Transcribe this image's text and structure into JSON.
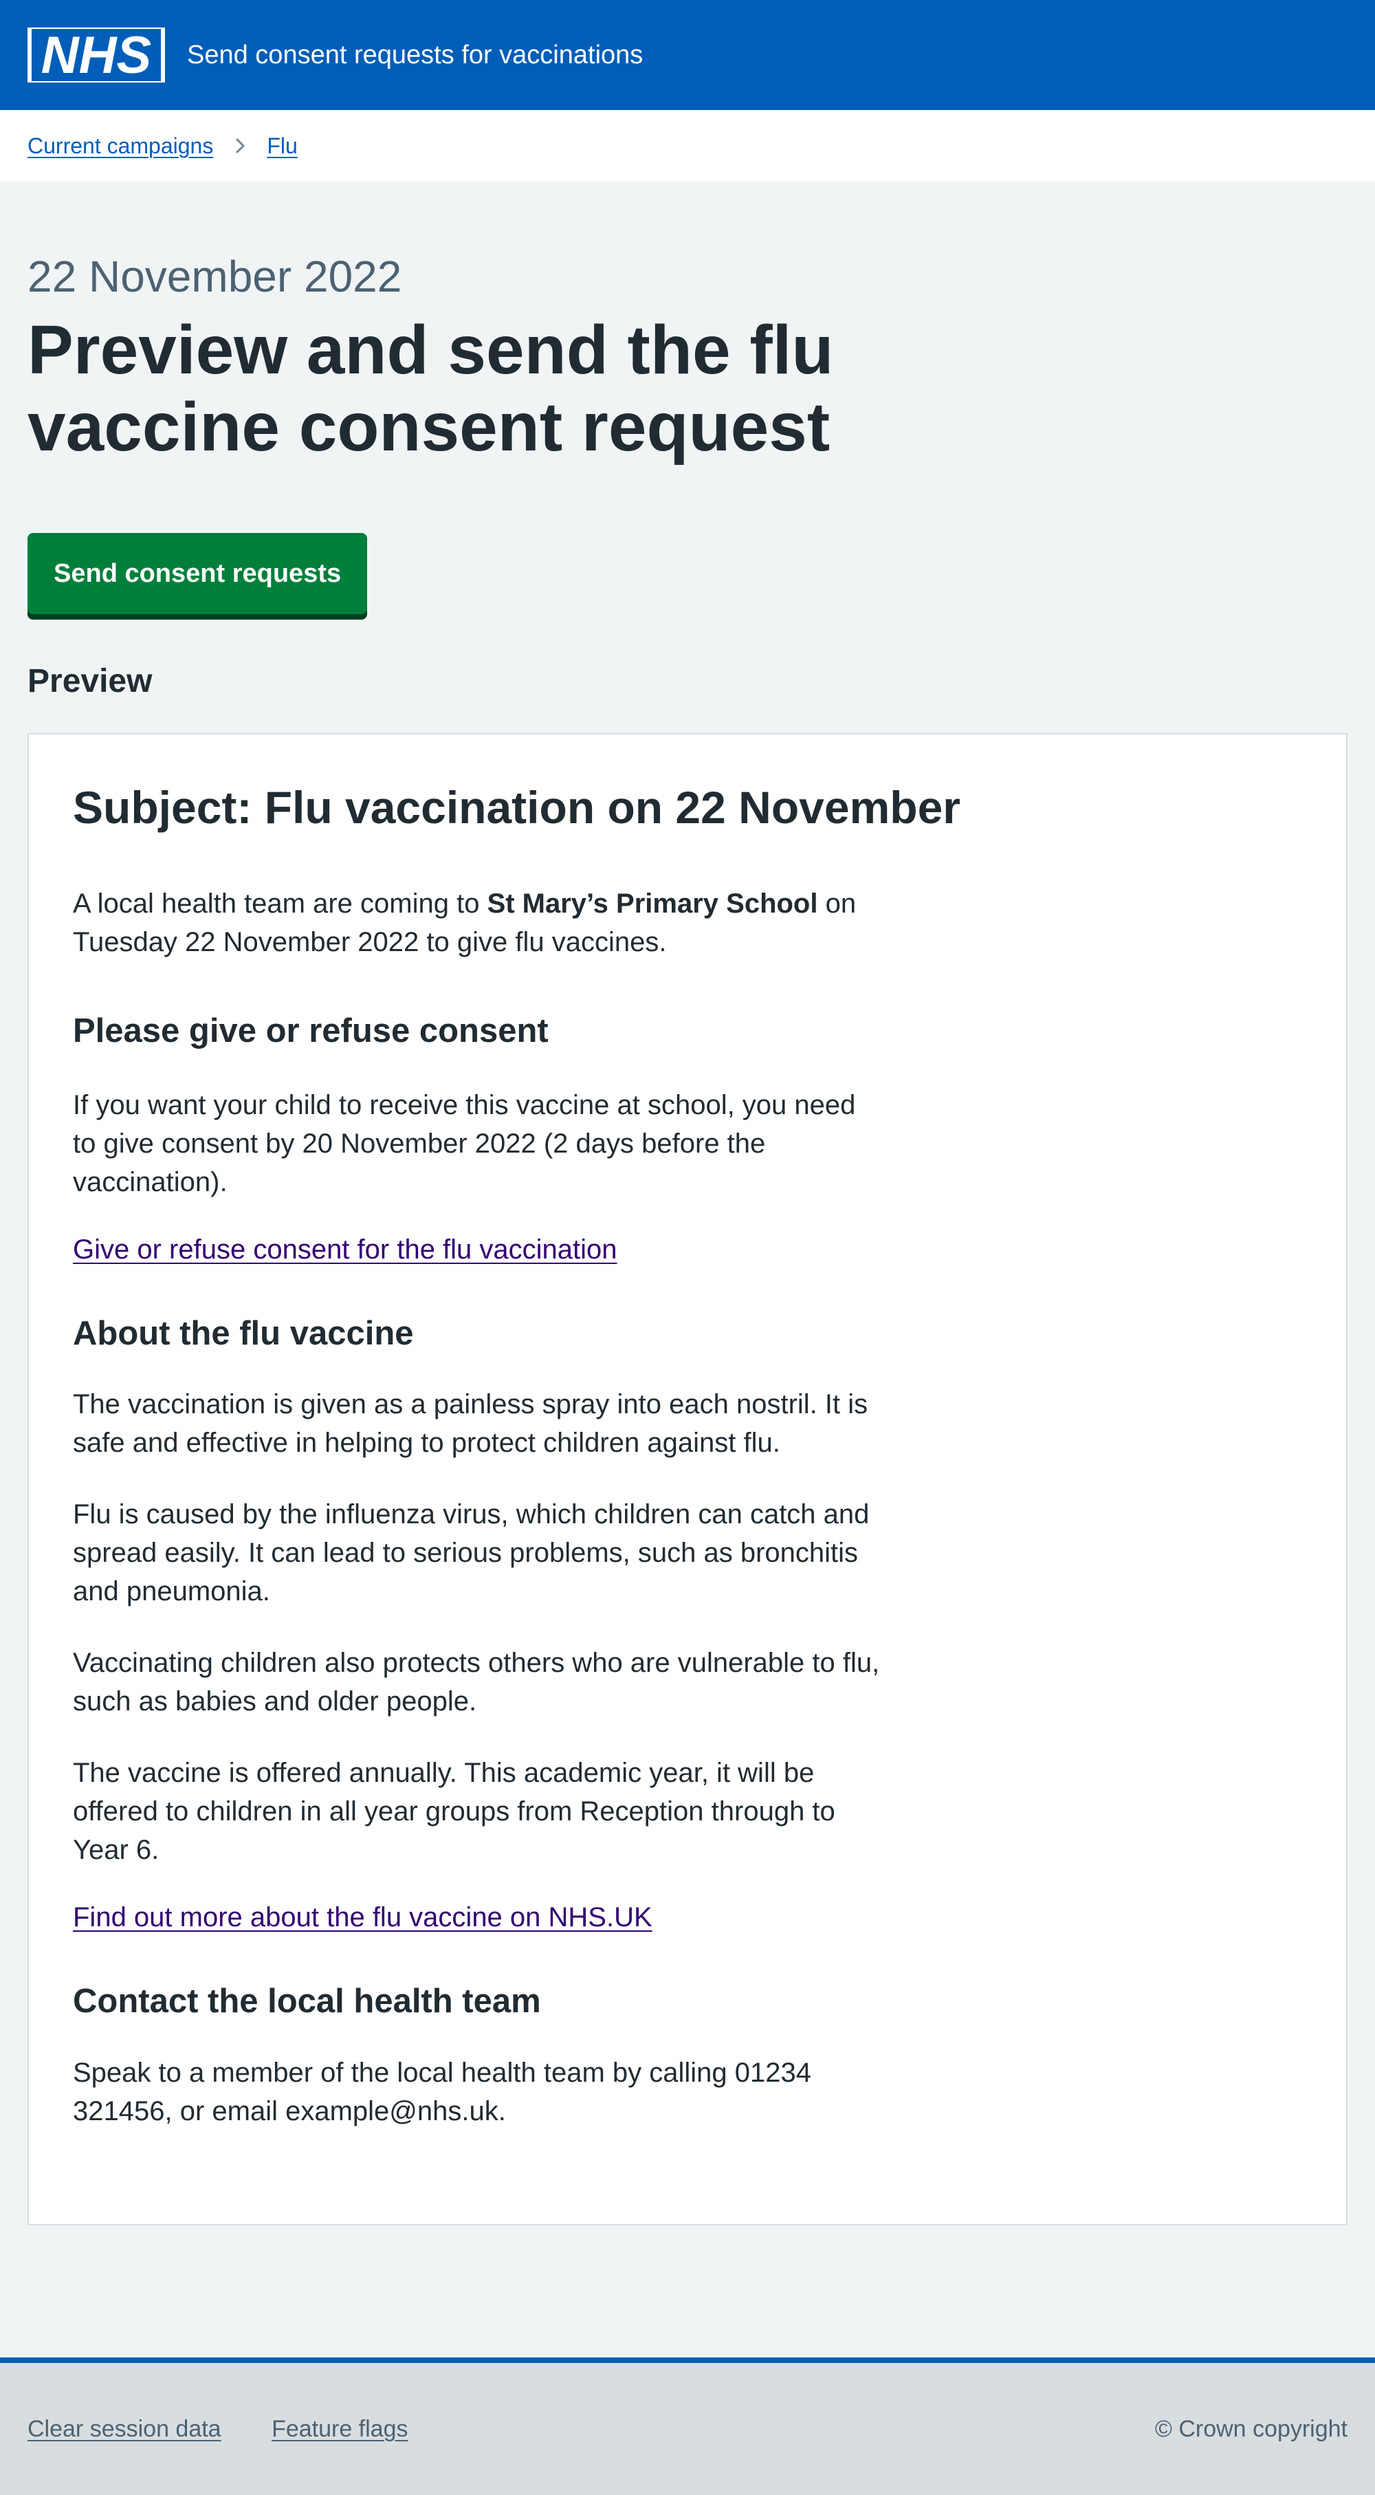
{
  "header": {
    "logo_text": "NHS",
    "service_name": "Send consent requests for vaccinations",
    "brand_color": "#005eb8"
  },
  "breadcrumb": {
    "items": [
      {
        "label": "Current campaigns"
      },
      {
        "label": "Flu"
      }
    ]
  },
  "page": {
    "caption": "22 November 2022",
    "title": "Preview and send the flu vaccine consent request",
    "send_button_label": "Send consent requests",
    "send_button_color": "#007f3b",
    "preview_heading": "Preview"
  },
  "email": {
    "subject": "Subject: Flu vaccination on 22 November",
    "intro_before": "A local health team are coming to ",
    "intro_school": "St Mary’s Primary School",
    "intro_after": " on Tuesday 22 November 2022 to give flu vaccines.",
    "consent_heading": "Please give or refuse consent",
    "consent_text": "If you want your child to receive this vaccine at school, you need to give consent by 20 November 2022 (2 days before the vaccination).",
    "consent_link": "Give or refuse consent for the flu vaccination",
    "about_heading": "About the flu vaccine",
    "about_p1": "The vaccination is given as a painless spray into each nostril. It is safe and effective in helping to protect children against flu.",
    "about_p2": "Flu is caused by the influenza virus, which children can catch and spread easily. It can lead to serious problems, such as bronchitis and pneumonia.",
    "about_p3": "Vaccinating children also protects others who are vulnerable to flu, such as babies and older people.",
    "about_p4": "The vaccine is offered annually. This academic year, it will be offered to children in all year groups from Reception through to Year 6.",
    "more_link": "Find out more about the flu vaccine on NHS.UK",
    "contact_heading": "Contact the local health team",
    "contact_text": "Speak to a member of the local health team by calling 01234 321456, or email example@nhs.uk."
  },
  "footer": {
    "links": [
      {
        "label": "Clear session data"
      },
      {
        "label": "Feature flags"
      }
    ],
    "copyright": "© Crown copyright"
  }
}
